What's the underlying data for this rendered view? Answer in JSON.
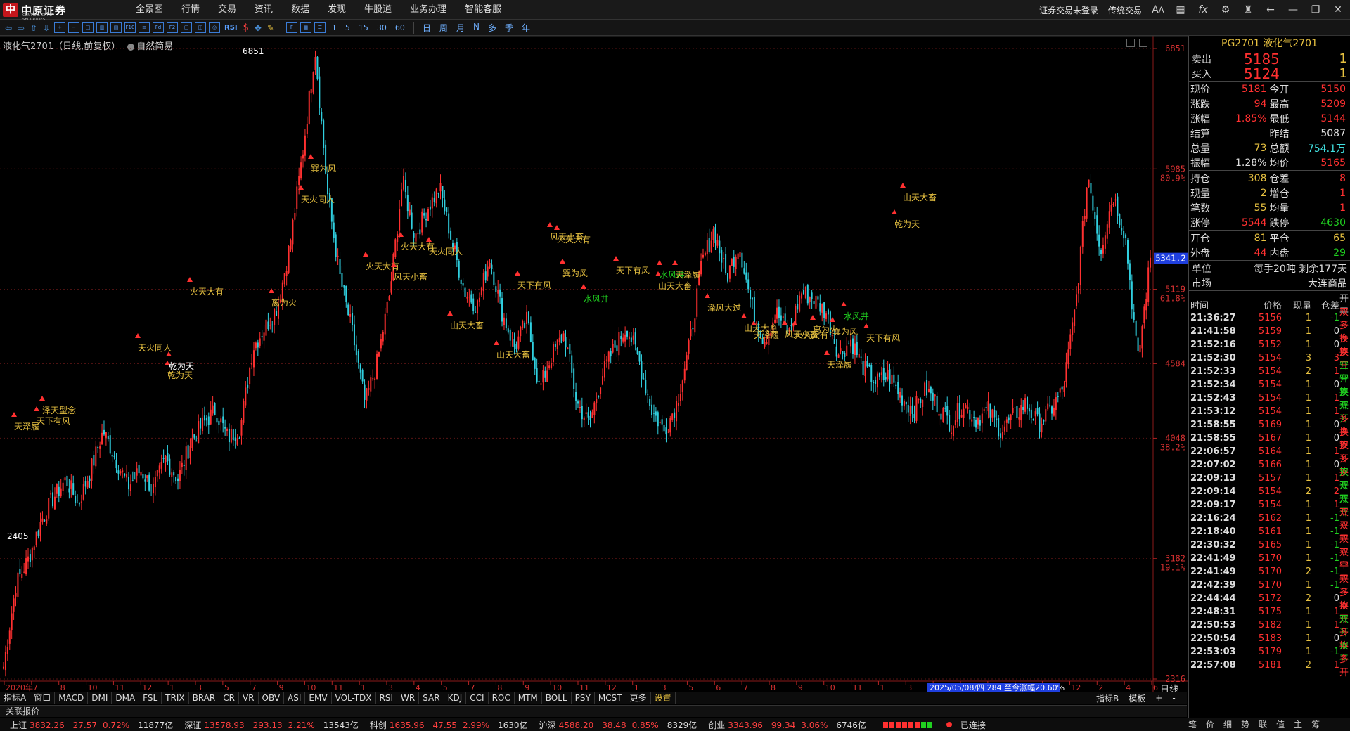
{
  "app": {
    "logo_text": "中原证券",
    "logo_sub": "CENTRAL CHINA SECURITIES",
    "menu": [
      "全景图",
      "行情",
      "交易",
      "资讯",
      "数据",
      "发现",
      "牛股道",
      "业务办理",
      "智能客服"
    ],
    "top_right": {
      "login": "证券交易未登录",
      "classic": "传统交易"
    },
    "top_icons": [
      "font-size-icon",
      "grid-icon",
      "fx-icon",
      "gear-icon",
      "shirt-icon",
      "back-icon",
      "minimize-icon",
      "restore-icon",
      "close-icon"
    ]
  },
  "toolbar": {
    "rsi": "RSI",
    "dollar": "$",
    "periods": [
      "1",
      "5",
      "15",
      "30",
      "60"
    ],
    "cn_periods": [
      "日",
      "周",
      "月",
      "N",
      "多",
      "季",
      "年"
    ]
  },
  "chart": {
    "title": "液化气2701（日线,前复权）",
    "indicator": "自然简易",
    "high_label": "6851",
    "low_label": "2405",
    "hover_price": "5341.2",
    "y_labels": [
      {
        "price": "6851",
        "pct": ""
      },
      {
        "price": "5985",
        "pct": "80.9%"
      },
      {
        "price": "5119",
        "pct": "61.8%"
      },
      {
        "price": "4584",
        "pct": ""
      },
      {
        "price": "4048",
        "pct": "38.2%"
      },
      {
        "price": "3182",
        "pct": "19.1%"
      },
      {
        "price": "2316",
        "pct": ""
      }
    ],
    "x_labels": [
      "2020年",
      "7",
      "8",
      "10",
      "11",
      "12",
      "1",
      "3",
      "5",
      "7",
      "9",
      "10",
      "11",
      "1",
      "3",
      "4",
      "5",
      "7",
      "8",
      "9",
      "10",
      "11",
      "12",
      "1",
      "3",
      "5",
      "6",
      "7",
      "8",
      "9",
      "10",
      "11",
      "1",
      "3",
      "4",
      "5",
      "6",
      "8",
      "10",
      "12",
      "2",
      "4",
      "6"
    ],
    "range_info": "2025/05/08/四 284 至今涨幅20.60%",
    "annotations": [
      {
        "text": "天泽履",
        "color": "#e6c040"
      },
      {
        "text": "泽天型念",
        "color": "#e6c040"
      },
      {
        "text": "天下有风",
        "color": "#e6c040"
      },
      {
        "text": "天火同人",
        "color": "#e6c040"
      },
      {
        "text": "乾为天",
        "color": "#ffffff"
      },
      {
        "text": "乾为天",
        "color": "#e6c040"
      },
      {
        "text": "火天大有",
        "color": "#e6c040"
      },
      {
        "text": "离为火",
        "color": "#e6c040"
      },
      {
        "text": "巽为风",
        "color": "#e6c040"
      },
      {
        "text": "天火同人",
        "color": "#e6c040"
      },
      {
        "text": "火天大有",
        "color": "#e6c040"
      },
      {
        "text": "风天小畜",
        "color": "#e6c040"
      },
      {
        "text": "火天大有",
        "color": "#e6c040"
      },
      {
        "text": "天火同人",
        "color": "#e6c040"
      },
      {
        "text": "山天大畜",
        "color": "#e6c040"
      },
      {
        "text": "山天大畜",
        "color": "#e6c040"
      },
      {
        "text": "天下有风",
        "color": "#e6c040"
      },
      {
        "text": "风天小畜",
        "color": "#e6c040"
      },
      {
        "text": "火天大有",
        "color": "#e6c040"
      },
      {
        "text": "巽为风",
        "color": "#e6c040"
      },
      {
        "text": "水风井",
        "color": "#20d020"
      },
      {
        "text": "天下有风",
        "color": "#e6c040"
      },
      {
        "text": "水风井",
        "color": "#20d020"
      },
      {
        "text": "天泽履",
        "color": "#e6c040"
      },
      {
        "text": "山天大畜",
        "color": "#e6c040"
      },
      {
        "text": "泽风大过",
        "color": "#e6c040"
      },
      {
        "text": "山天大畜",
        "color": "#e6c040"
      },
      {
        "text": "天泽履",
        "color": "#e6c040"
      },
      {
        "text": "风天小畜",
        "color": "#e6c040"
      },
      {
        "text": "离为火",
        "color": "#e6c040"
      },
      {
        "text": "火天大有",
        "color": "#e6c040"
      },
      {
        "text": "巽为风",
        "color": "#e6c040"
      },
      {
        "text": "水风井",
        "color": "#20d020"
      },
      {
        "text": "天下有风",
        "color": "#e6c040"
      },
      {
        "text": "天泽履",
        "color": "#e6c040"
      },
      {
        "text": "乾为天",
        "color": "#e6c040"
      },
      {
        "text": "山天大畜",
        "color": "#e6c040"
      }
    ]
  },
  "indicator_tabs": [
    "指标A",
    "窗口",
    "MACD",
    "DMI",
    "DMA",
    "FSL",
    "TRIX",
    "BRAR",
    "CR",
    "VR",
    "OBV",
    "ASI",
    "EMV",
    "VOL-TDX",
    "RSI",
    "WR",
    "SAR",
    "KDJ",
    "CCI",
    "ROC",
    "MTM",
    "BOLL",
    "PSY",
    "MCST",
    "更多",
    "设置"
  ],
  "indicator_right": [
    "指标B",
    "模板",
    "+",
    "-"
  ],
  "period_tag": "日线",
  "link_bar": "关联报价",
  "status": {
    "indices": [
      {
        "name": "上证",
        "value": "3832.26",
        "chg": "27.57",
        "pct": "0.72%",
        "amount": "11877亿"
      },
      {
        "name": "深证",
        "value": "13578.93",
        "chg": "293.13",
        "pct": "2.21%",
        "amount": "13543亿"
      },
      {
        "name": "科创",
        "value": "1635.96",
        "chg": "47.55",
        "pct": "2.99%",
        "amount": "1630亿"
      },
      {
        "name": "沪深",
        "value": "4588.20",
        "chg": "38.48",
        "pct": "0.85%",
        "amount": "8329亿"
      },
      {
        "name": "创业",
        "value": "3343.96",
        "chg": "99.34",
        "pct": "3.06%",
        "amount": "6746亿"
      }
    ],
    "connection": "已连接",
    "right_tabs": [
      "笔",
      "价",
      "细",
      "势",
      "联",
      "值",
      "主",
      "筹"
    ]
  },
  "quote": {
    "title": "PG2701 液化气2701",
    "sell": {
      "label": "卖出",
      "price": "5185",
      "qty": "1"
    },
    "buy": {
      "label": "买入",
      "price": "5124",
      "qty": "1"
    },
    "stats": [
      [
        "现价",
        "5181",
        "red",
        "今开",
        "5150",
        "red"
      ],
      [
        "涨跌",
        "94",
        "red",
        "最高",
        "5209",
        "red"
      ],
      [
        "涨幅",
        "1.85%",
        "red",
        "最低",
        "5144",
        "red"
      ],
      [
        "结算",
        "",
        "white",
        "昨结",
        "5087",
        "white"
      ],
      [
        "总量",
        "73",
        "yellow",
        "总额",
        "754.1万",
        "cyan"
      ],
      [
        "振幅",
        "1.28%",
        "white",
        "均价",
        "5165",
        "red"
      ]
    ],
    "stats2": [
      [
        "持仓",
        "308",
        "yellow",
        "仓差",
        "8",
        "red"
      ],
      [
        "现量",
        "2",
        "yellow",
        "增仓",
        "1",
        "red"
      ],
      [
        "笔数",
        "55",
        "yellow",
        "均量",
        "1",
        "red"
      ],
      [
        "涨停",
        "5544",
        "red",
        "跌停",
        "4630",
        "green"
      ]
    ],
    "stats3": [
      [
        "开仓",
        "81",
        "yellow",
        "平仓",
        "65",
        "yellow"
      ],
      [
        "外盘",
        "44",
        "red",
        "内盘",
        "29",
        "green"
      ]
    ],
    "unit": {
      "label": "单位",
      "value": "每手20吨  剩余177天"
    },
    "market": {
      "label": "市场",
      "value": "大连商品"
    },
    "ticks_header": [
      "时间",
      "价格",
      "现量",
      "仓差",
      "开平"
    ],
    "ticks": [
      [
        "21:36:27",
        "5156",
        "1",
        "-1",
        "双平",
        "red"
      ],
      [
        "21:41:58",
        "5159",
        "1",
        "0",
        "多换",
        "red"
      ],
      [
        "21:52:16",
        "5152",
        "1",
        "0",
        "多换",
        "red"
      ],
      [
        "21:52:30",
        "5154",
        "3",
        "3",
        "双开",
        "red"
      ],
      [
        "21:52:33",
        "5154",
        "2",
        "1",
        "空开",
        "green"
      ],
      [
        "21:52:34",
        "5154",
        "1",
        "0",
        "空换",
        "green"
      ],
      [
        "21:52:43",
        "5154",
        "1",
        "1",
        "双开",
        "green"
      ],
      [
        "21:53:12",
        "5154",
        "1",
        "1",
        "双开",
        "green"
      ],
      [
        "21:58:55",
        "5169",
        "1",
        "0",
        "多换",
        "red"
      ],
      [
        "21:58:55",
        "5167",
        "1",
        "0",
        "多换",
        "red"
      ],
      [
        "22:06:57",
        "5164",
        "1",
        "1",
        "双开",
        "red"
      ],
      [
        "22:07:02",
        "5166",
        "1",
        "0",
        "多换",
        "red"
      ],
      [
        "22:09:13",
        "5157",
        "1",
        "1",
        "双开",
        "green"
      ],
      [
        "22:09:14",
        "5154",
        "2",
        "2",
        "双开",
        "green"
      ],
      [
        "22:09:17",
        "5154",
        "1",
        "1",
        "双开",
        "green"
      ],
      [
        "22:16:24",
        "5162",
        "1",
        "-1",
        "双平",
        "red"
      ],
      [
        "22:18:40",
        "5161",
        "1",
        "-1",
        "双平",
        "red"
      ],
      [
        "22:30:32",
        "5165",
        "1",
        "-1",
        "双平",
        "red"
      ],
      [
        "22:41:49",
        "5170",
        "1",
        "-1",
        "双平",
        "red"
      ],
      [
        "22:41:49",
        "5170",
        "2",
        "-1",
        "空平",
        "red"
      ],
      [
        "22:42:39",
        "5170",
        "1",
        "-1",
        "双平",
        "red"
      ],
      [
        "22:44:44",
        "5172",
        "2",
        "0",
        "多换",
        "red"
      ],
      [
        "22:48:31",
        "5175",
        "1",
        "1",
        "双开",
        "red"
      ],
      [
        "22:50:53",
        "5182",
        "1",
        "1",
        "双开",
        "green"
      ],
      [
        "22:50:54",
        "5183",
        "1",
        "0",
        "多换",
        "red"
      ],
      [
        "22:53:03",
        "5179",
        "1",
        "-1",
        "双平",
        "green"
      ],
      [
        "22:57:08",
        "5181",
        "2",
        "1",
        "多开",
        "red"
      ]
    ]
  },
  "chart_data": {
    "type": "candlestick",
    "title": "液化气2701（日线,前复权）",
    "ylim": [
      2316,
      6851
    ],
    "y_ticks": [
      6851,
      5985,
      5119,
      4584,
      4048,
      3182,
      2316
    ],
    "fib_levels": {
      "80.9%": 5985,
      "61.8%": 5119,
      "38.2%": 4048,
      "19.1%": 3182
    },
    "close_series": [
      2405,
      3000,
      3180,
      3450,
      3620,
      3750,
      3580,
      3820,
      4100,
      3900,
      3700,
      3820,
      3680,
      3900,
      3750,
      4020,
      4150,
      4250,
      4050,
      4120,
      4700,
      4850,
      5000,
      5450,
      6100,
      6851,
      5800,
      5200,
      4800,
      4300,
      4600,
      5100,
      5900,
      5500,
      5700,
      5850,
      5450,
      5100,
      5000,
      5350,
      4950,
      4700,
      4900,
      4400,
      4650,
      4800,
      4300,
      4150,
      4500,
      4700,
      4850,
      4600,
      4250,
      4100,
      4300,
      4700,
      5300,
      5550,
      5200,
      5450,
      5000,
      4750,
      4950,
      4800,
      5100,
      5050,
      4950,
      4650,
      4750,
      4550,
      4450,
      4500,
      4350,
      4250,
      4400,
      4280,
      4150,
      4300,
      4180,
      4250,
      4100,
      4200,
      4300,
      4150,
      4250,
      4400,
      5000,
      5950,
      5400,
      5800,
      5500,
      4600,
      5341
    ]
  }
}
